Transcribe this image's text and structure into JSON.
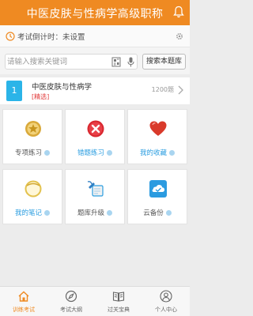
{
  "header": {
    "title": "中医皮肤与性病学高级职称"
  },
  "countdown": {
    "text": "考试倒计时：未设置"
  },
  "search": {
    "placeholder": "请输入搜索关键词",
    "button_label": "搜索本题库"
  },
  "subject": {
    "number": "1",
    "name": "中医皮肤与性病学",
    "tag": "[精选]",
    "count": "1200题"
  },
  "grid": [
    {
      "label": "专项练习",
      "color": "#555555",
      "icon": "medal-icon"
    },
    {
      "label": "错题练习",
      "color": "#2a9de0",
      "icon": "wrong-x-icon"
    },
    {
      "label": "我的收藏",
      "color": "#2a9de0",
      "icon": "heart-icon"
    },
    {
      "label": "我的笔记",
      "color": "#2a9de0",
      "icon": "notebook-icon"
    },
    {
      "label": "题库升级",
      "color": "#555555",
      "icon": "upgrade-icon"
    },
    {
      "label": "云备份",
      "color": "#555555",
      "icon": "cloud-backup-icon"
    }
  ],
  "nav": [
    {
      "label": "训练考试",
      "icon": "home-icon",
      "active": true
    },
    {
      "label": "考试大纲",
      "icon": "compass-icon",
      "active": false
    },
    {
      "label": "过关宝典",
      "icon": "book-icon",
      "active": false
    },
    {
      "label": "个人中心",
      "icon": "person-icon",
      "active": false
    }
  ],
  "colors": {
    "brand": "#ef8a22",
    "accent": "#2bb4e8",
    "tag_red": "#e23b3b"
  }
}
